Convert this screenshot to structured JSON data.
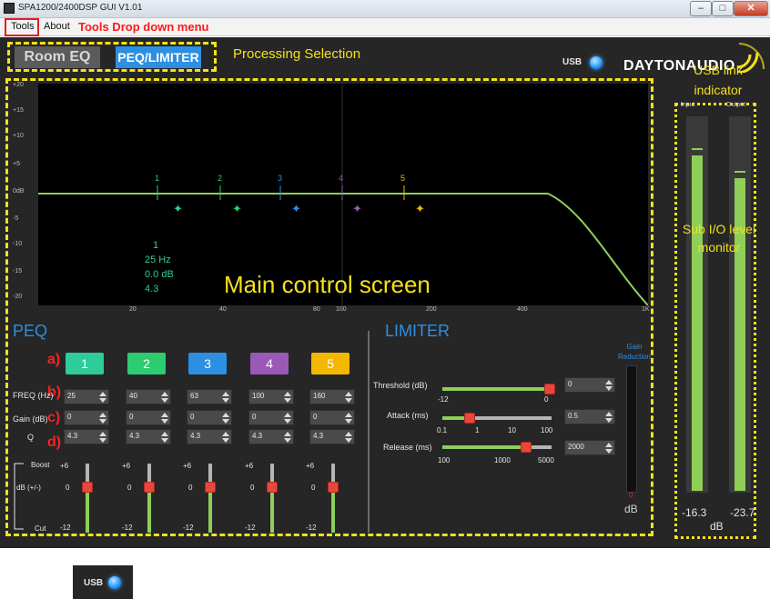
{
  "window": {
    "title": "SPA1200/2400DSP GUI V1.01",
    "minimize": "–",
    "maximize": "□",
    "close": "✕"
  },
  "menu": {
    "items": [
      "Tools",
      "About"
    ],
    "annotation": "Tools Drop down menu"
  },
  "processing": {
    "tabs": [
      "Room EQ",
      "PEQ/LIMITER"
    ],
    "active_tab": "PEQ/LIMITER",
    "annotation": "Processing Selection"
  },
  "usb": {
    "label": "USB",
    "annotation": "USB link indicator"
  },
  "brand": {
    "logo": "DAYTONAUDIO"
  },
  "graph": {
    "annotation": "Main control screen",
    "y_ticks": [
      "+20",
      "+15",
      "+10",
      "+5",
      "0dB",
      "-5",
      "-10",
      "-15",
      "-20"
    ],
    "x_ticks": [
      "20",
      "40",
      "80",
      "100",
      "200",
      "400",
      "1K"
    ],
    "band_markers": [
      "1",
      "2",
      "3",
      "4",
      "5"
    ],
    "selected_band_info": [
      "1",
      "25 Hz",
      "0.0 dB",
      "4.3"
    ],
    "colors": {
      "curve": "#8fcf57",
      "band1": "#2ecc9a",
      "band2": "#2ecc71",
      "band3": "#2d8fe1",
      "band4": "#9b59b6",
      "band5": "#f5b800"
    }
  },
  "peq": {
    "title": "PEQ",
    "row_labels": [
      "FREQ (Hz)",
      "Gain (dB)",
      "Q"
    ],
    "annotations": [
      "a)",
      "b)",
      "c)",
      "d)"
    ],
    "bands": [
      {
        "label": "1",
        "color": "#2ecc9a",
        "freq": "25",
        "gain": "0",
        "q": "4.3"
      },
      {
        "label": "2",
        "color": "#2ecc71",
        "freq": "40",
        "gain": "0",
        "q": "4.3"
      },
      {
        "label": "3",
        "color": "#2d8fe1",
        "freq": "63",
        "gain": "0",
        "q": "4.3"
      },
      {
        "label": "4",
        "color": "#9b59b6",
        "freq": "100",
        "gain": "0",
        "q": "4.3"
      },
      {
        "label": "5",
        "color": "#f5b800",
        "freq": "160",
        "gain": "0",
        "q": "4.3"
      }
    ],
    "slider_legend": [
      "Boost",
      "dB (+/-)",
      "Cut"
    ],
    "slider_scale": [
      "+6",
      "0",
      "-12"
    ]
  },
  "limiter": {
    "title": "LIMITER",
    "threshold": {
      "label": "Threshold (dB)",
      "value": "0",
      "scale": [
        "-12",
        "0"
      ],
      "fraction": 0.98
    },
    "attack": {
      "label": "Attack (ms)",
      "value": "0.5",
      "scale": [
        "0.1",
        "1",
        "10",
        "100"
      ],
      "fraction": 0.25
    },
    "release": {
      "label": "Release (ms)",
      "value": "2000",
      "scale": [
        "100",
        "1000",
        "5000"
      ],
      "fraction": 0.77
    },
    "gain_reduction": {
      "label": "Gain Reduction",
      "value": "0",
      "unit": "dB"
    }
  },
  "meters": {
    "headers": [
      "Input",
      "Output"
    ],
    "values": [
      "-16.3",
      "-23.7"
    ],
    "unit": "dB",
    "annotation": "Sub I/O level monitor",
    "input_level": 0.9,
    "output_level": 0.84
  }
}
